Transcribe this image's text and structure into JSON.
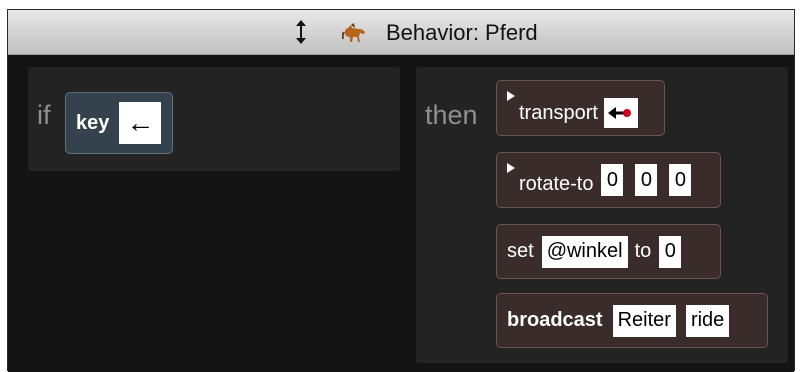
{
  "titlebar": {
    "title": "Behavior: Pferd",
    "resize_icon": "vertical-resize-icon",
    "entity_icon": "horse-icon"
  },
  "condition": {
    "if_label": "if",
    "block_label": "key",
    "key_value": "←"
  },
  "actions": {
    "then_label": "then",
    "transport": {
      "label": "transport",
      "icon": "arrow-target-icon"
    },
    "rotate_to": {
      "label": "rotate-to",
      "x": "0",
      "y": "0",
      "z": "0"
    },
    "set": {
      "label": "set",
      "variable": "@winkel",
      "to_label": "to",
      "value": "0"
    },
    "broadcast": {
      "label": "broadcast",
      "target": "Reiter",
      "message": "ride"
    }
  },
  "colors": {
    "background": "#1c1c1c",
    "panel": "#232323",
    "action_block": "#3a2c2a",
    "key_block": "#34424e"
  }
}
